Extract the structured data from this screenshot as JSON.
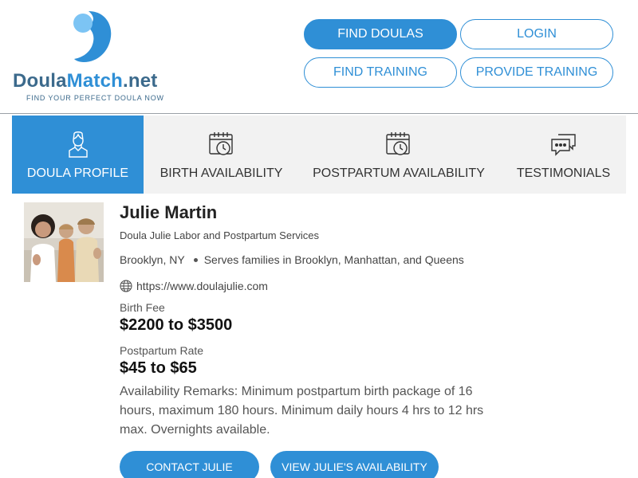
{
  "brand": {
    "name_part1": "Doula",
    "name_part2": "Match",
    "name_part3": ".net",
    "tagline": "FIND YOUR PERFECT DOULA NOW",
    "primary_color": "#2f8fd6",
    "secondary_color": "#3c6a8c"
  },
  "header_nav": {
    "find_doulas": "FIND DOULAS",
    "login": "LOGIN",
    "find_training": "FIND TRAINING",
    "provide_training": "PROVIDE TRAINING"
  },
  "tabs": [
    {
      "label": "DOULA PROFILE",
      "icon": "person-icon",
      "active": true
    },
    {
      "label": "BIRTH AVAILABILITY",
      "icon": "calendar-clock-icon",
      "active": false
    },
    {
      "label": "POSTPARTUM AVAILABILITY",
      "icon": "calendar-clock-icon",
      "active": false
    },
    {
      "label": "TESTIMONIALS",
      "icon": "chat-bubbles-icon",
      "active": false
    }
  ],
  "profile": {
    "name": "Julie Martin",
    "business": "Doula Julie Labor and Postpartum Services",
    "city": "Brooklyn, NY",
    "serves": "Serves families in Brooklyn, Manhattan, and Queens",
    "website": "https://www.doulajulie.com",
    "birth_fee_label": "Birth Fee",
    "birth_fee": "$2200 to $3500",
    "postpartum_rate_label": "Postpartum Rate",
    "postpartum_rate": "$45 to $65",
    "remarks": "Availability Remarks: Minimum postpartum birth package of 16 hours, maximum 180 hours. Minimum daily hours 4 hrs to 12 hrs max. Overnights available."
  },
  "actions": {
    "contact": "CONTACT JULIE",
    "availability": "VIEW JULIE'S AVAILABILITY"
  }
}
